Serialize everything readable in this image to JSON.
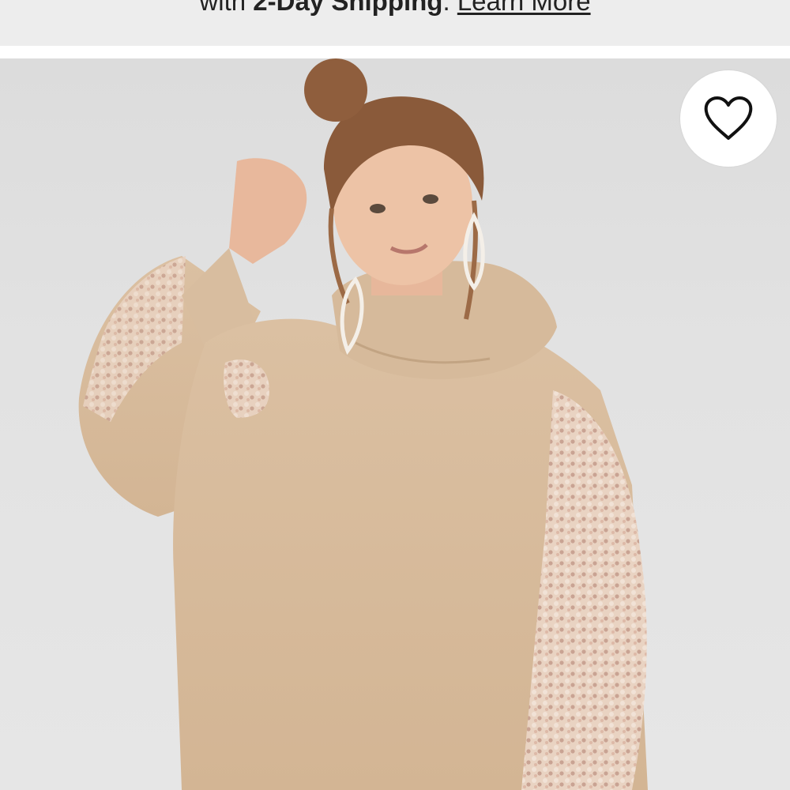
{
  "banner": {
    "text_prefix": "with ",
    "text_bold": "2-Day Shipping",
    "text_suffix": ". ",
    "link_label": "Learn More"
  },
  "product": {
    "image_icon": "product-photo-model-in-tan-cowl-neck-sweater",
    "favorite_icon": "heart-outline-icon"
  },
  "colors": {
    "banner_bg": "#ededed",
    "photo_bg": "#e2e2e2",
    "sweater": "#d9bc9b",
    "sleeve_texture": "#e8cdb8"
  }
}
